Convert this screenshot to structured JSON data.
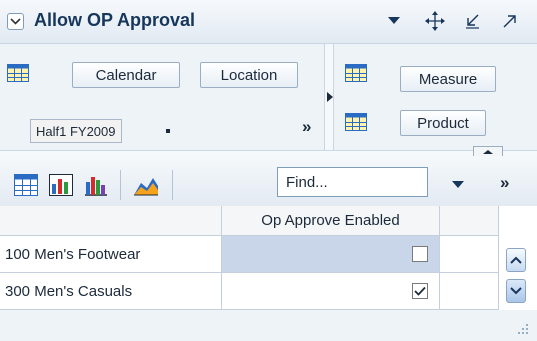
{
  "header": {
    "title": "Allow OP Approval",
    "icons": [
      "collapse-icon",
      "dropdown-icon",
      "move-icon",
      "minimize-icon",
      "maximize-icon"
    ]
  },
  "layout": {
    "row_tiles": [
      "Calendar",
      "Location"
    ],
    "selected_member": "Half1 FY2009",
    "more_symbol": "»",
    "column_tiles": [
      "Measure",
      "Product"
    ]
  },
  "toolbar": {
    "find_placeholder": "Find...",
    "overflow_symbol": "»",
    "icons": [
      "grid-view-icon",
      "chart-view-icon",
      "bar-chart-icon",
      "area-chart-icon",
      "dropdown-icon"
    ]
  },
  "grid": {
    "column_headers": [
      "Op Approve Enabled"
    ],
    "rows": [
      {
        "label": "100 Men's Footwear",
        "op_approve_enabled": false,
        "selected": true
      },
      {
        "label": "300 Men's Casuals",
        "op_approve_enabled": true,
        "selected": false
      }
    ]
  },
  "colors": {
    "header_title": "#16365c",
    "panel_bg": "#eef3f8",
    "selected_cell": "#c9d6ea",
    "grid_border": "#c4cfdb",
    "chart_orange": "#f7a21b",
    "chart_blue": "#2a6cc4"
  }
}
